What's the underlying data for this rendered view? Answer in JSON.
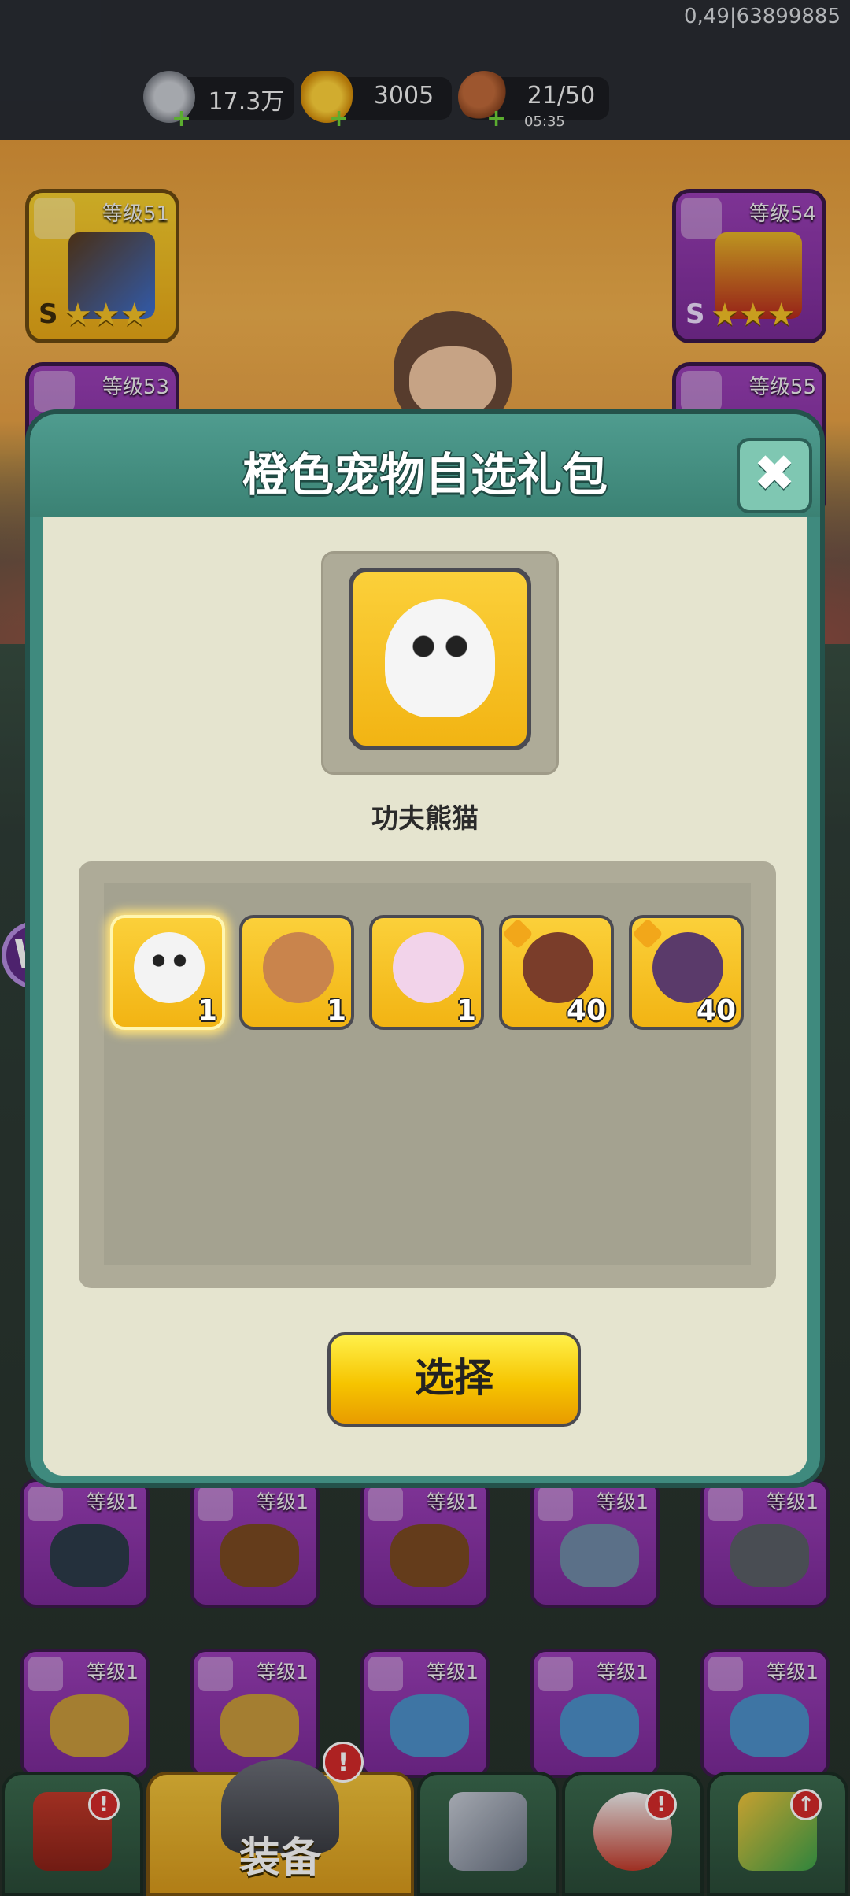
{
  "debug_label": "0,49|63899885",
  "resources": [
    {
      "name": "silver-coin",
      "value": "17.3万",
      "timer": ""
    },
    {
      "name": "gold-ingot",
      "value": "3005",
      "timer": ""
    },
    {
      "name": "drumstick-stamina",
      "value": "21/50",
      "timer": "05:35"
    }
  ],
  "equipment_slots": [
    {
      "level": "等级51",
      "rank": "S",
      "stars": "★★★",
      "color": "gold"
    },
    {
      "level": "等级54",
      "rank": "S",
      "stars": "★★★",
      "color": "purple"
    },
    {
      "level": "等级53",
      "rank": "",
      "stars": "",
      "color": "purple"
    },
    {
      "level": "等级55",
      "rank": "",
      "stars": "",
      "color": "purple"
    }
  ],
  "inventory_row1": [
    "等级1",
    "等级1",
    "等级1",
    "等级1",
    "等级1"
  ],
  "inventory_row2": [
    "等级1",
    "等级1",
    "等级1",
    "等级1",
    "等级1"
  ],
  "dialog": {
    "title": "橙色宠物自选礼包",
    "close_glyph": "✖",
    "selected_name": "功夫熊猫",
    "select_button": "选择",
    "pets": [
      {
        "id": "kungfu-panda",
        "qty": "1",
        "selected": true,
        "color": "#f3f3f3"
      },
      {
        "id": "deer",
        "qty": "1",
        "selected": false,
        "color": "#c9844c"
      },
      {
        "id": "unicorn",
        "qty": "1",
        "selected": false,
        "color": "#f2d3ea"
      },
      {
        "id": "hero-girl-1",
        "qty": "40",
        "selected": false,
        "color": "#7a3d2a"
      },
      {
        "id": "hero-girl-2",
        "qty": "40",
        "selected": false,
        "color": "#5a3a6a"
      }
    ]
  },
  "bottom_nav": [
    {
      "id": "shop",
      "label": "",
      "badge": "!"
    },
    {
      "id": "equipment",
      "label": "装备",
      "badge": "!"
    },
    {
      "id": "battle",
      "label": "",
      "badge": ""
    },
    {
      "id": "pets",
      "label": "",
      "badge": "!"
    },
    {
      "id": "upgrade",
      "label": "",
      "badge": "↑"
    }
  ],
  "colors": {
    "accent_teal": "#3f8a7e",
    "gold": "#f6c400",
    "purple": "#8a33a8"
  }
}
